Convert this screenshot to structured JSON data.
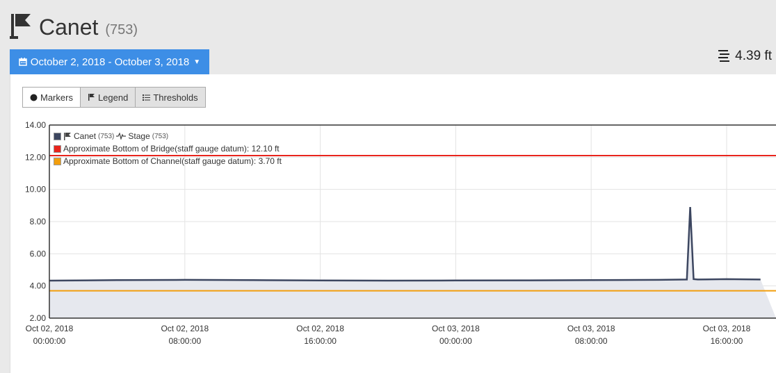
{
  "header": {
    "title": "Canet",
    "id_label": "(753)",
    "icon": "flag-icon"
  },
  "date_range": {
    "label": "October 2, 2018 - October 3, 2018",
    "icon": "calendar-icon"
  },
  "current_stage": {
    "value": "4.39 ft",
    "icon": "water-level-icon"
  },
  "controls": {
    "markers": "Markers",
    "legend": "Legend",
    "thresholds": "Thresholds"
  },
  "legend": {
    "series_name": "Canet",
    "series_id": "(753)",
    "series_type": "Stage",
    "series_type_id": "(753)",
    "threshold_1": "Approximate Bottom of Bridge(staff gauge datum): 12.10 ft",
    "threshold_2": "Approximate Bottom of Channel(staff gauge datum): 3.70 ft"
  },
  "colors": {
    "series": "#3c4660",
    "threshold_bridge": "#e8241c",
    "threshold_channel": "#f29e0c",
    "accent": "#3d8ee6"
  },
  "chart_data": {
    "type": "line",
    "ylim": [
      2,
      14
    ],
    "yticks": [
      "2.00",
      "4.00",
      "6.00",
      "8.00",
      "10.00",
      "12.00",
      "14.00"
    ],
    "xticks": [
      {
        "date": "Oct 02, 2018",
        "time": "00:00:00",
        "hours": 0
      },
      {
        "date": "Oct 02, 2018",
        "time": "08:00:00",
        "hours": 8
      },
      {
        "date": "Oct 02, 2018",
        "time": "16:00:00",
        "hours": 16
      },
      {
        "date": "Oct 03, 2018",
        "time": "00:00:00",
        "hours": 24
      },
      {
        "date": "Oct 03, 2018",
        "time": "08:00:00",
        "hours": 32
      },
      {
        "date": "Oct 03, 2018",
        "time": "16:00:00",
        "hours": 40
      }
    ],
    "series": [
      {
        "name": "Canet (753) Stage (753)",
        "x_hours": [
          0,
          4,
          8,
          12,
          16,
          20,
          24,
          28,
          32,
          36,
          37.65,
          37.85,
          38.05,
          38.3,
          40,
          42
        ],
        "values": [
          4.33,
          4.36,
          4.38,
          4.36,
          4.34,
          4.33,
          4.34,
          4.35,
          4.36,
          4.38,
          4.4,
          8.9,
          4.42,
          4.4,
          4.42,
          4.4
        ]
      }
    ],
    "thresholds": [
      {
        "value": 12.1
      },
      {
        "value": 3.7
      }
    ],
    "grid": true
  }
}
